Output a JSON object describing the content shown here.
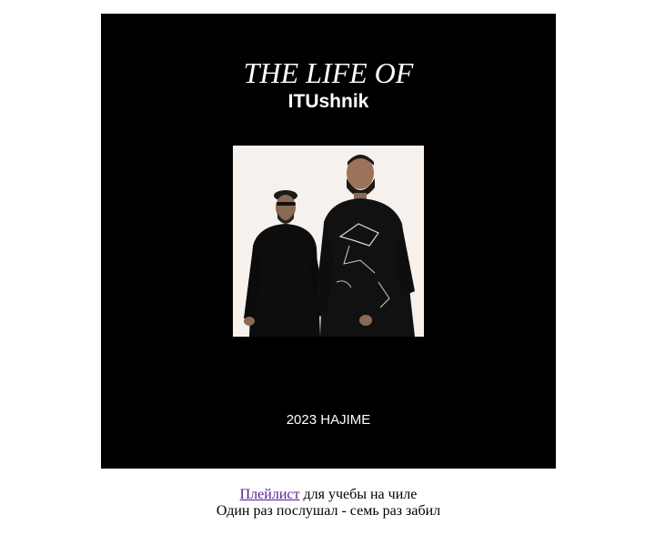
{
  "cover": {
    "title_line1": "THE LIFE OF",
    "title_line2": "ITUshnik",
    "bottom_text": "2023 HAJIME",
    "background": "#000000",
    "text_color": "#ffffff",
    "photo_background": "#f6f1ed"
  },
  "caption": {
    "link_text": "Плейлист",
    "line1_rest": " для учебы на чиле",
    "line2": "Один раз послушал - семь раз забил",
    "link_color": "#551a8b"
  }
}
